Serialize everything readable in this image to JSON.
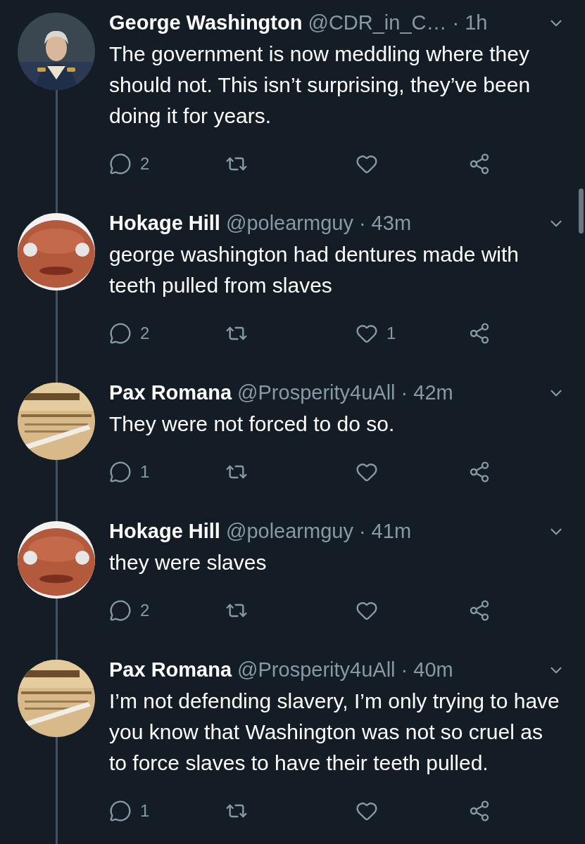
{
  "tweets": [
    {
      "name": "George Washington",
      "handle": "@CDR_in_C…",
      "time": "· 1h",
      "body": "The government is now meddling where they should not. This isn’t surprising, they’ve been doing it for years.",
      "replies": "2"
    },
    {
      "name": "Hokage Hill",
      "handle": "@polearmguy",
      "time": "· 43m",
      "body": "george washington had dentures made with teeth pulled from slaves",
      "replies": "2",
      "likes": "1"
    },
    {
      "name": "Pax Romana",
      "handle": "@Prosperity4uAll",
      "time": "· 42m",
      "body": "They were not forced to do so.",
      "replies": "1"
    },
    {
      "name": "Hokage Hill",
      "handle": "@polearmguy",
      "time": "· 41m",
      "body": "they were slaves",
      "replies": "2"
    },
    {
      "name": "Pax Romana",
      "handle": "@Prosperity4uAll",
      "time": "· 40m",
      "body": "I’m not defending slavery, I’m only trying to have you know that Washington was not so cruel as to force slaves to have their teeth pulled.",
      "replies": "1"
    }
  ]
}
